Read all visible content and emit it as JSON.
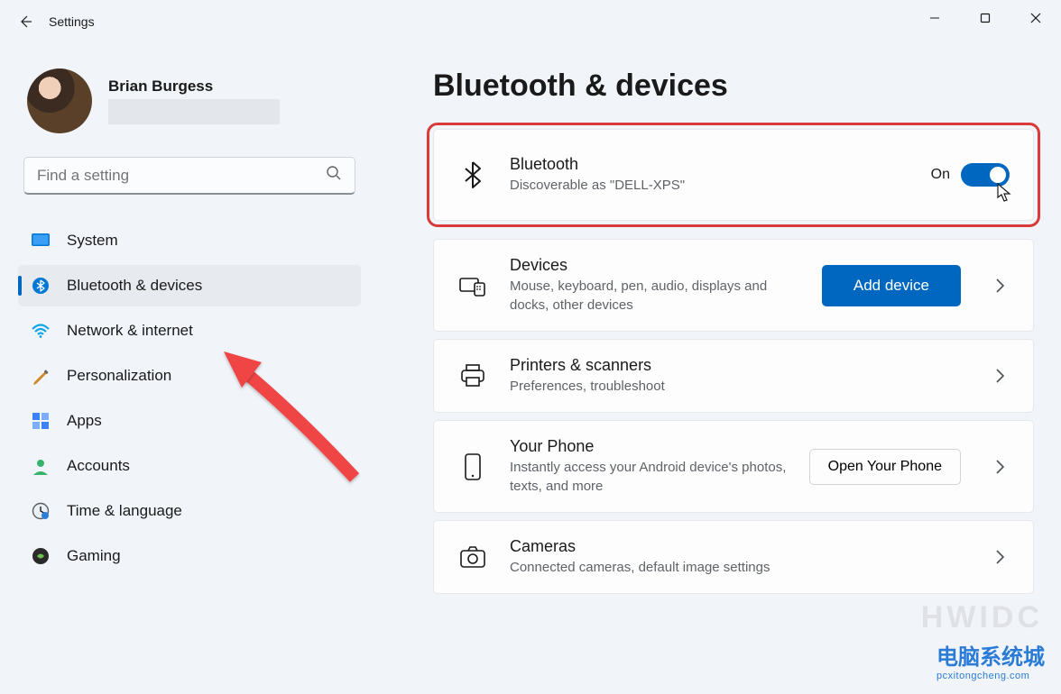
{
  "window": {
    "title": "Settings"
  },
  "profile": {
    "name": "Brian Burgess"
  },
  "search": {
    "placeholder": "Find a setting"
  },
  "sidebar": {
    "items": [
      {
        "label": "System"
      },
      {
        "label": "Bluetooth & devices"
      },
      {
        "label": "Network & internet"
      },
      {
        "label": "Personalization"
      },
      {
        "label": "Apps"
      },
      {
        "label": "Accounts"
      },
      {
        "label": "Time & language"
      },
      {
        "label": "Gaming"
      }
    ]
  },
  "page": {
    "title": "Bluetooth & devices"
  },
  "cards": {
    "bluetooth": {
      "title": "Bluetooth",
      "sub": "Discoverable as \"DELL-XPS\"",
      "toggle_label": "On"
    },
    "devices": {
      "title": "Devices",
      "sub": "Mouse, keyboard, pen, audio, displays and docks, other devices",
      "button": "Add device"
    },
    "printers": {
      "title": "Printers & scanners",
      "sub": "Preferences, troubleshoot"
    },
    "phone": {
      "title": "Your Phone",
      "sub": "Instantly access your Android device's photos, texts, and more",
      "button": "Open Your Phone"
    },
    "cameras": {
      "title": "Cameras",
      "sub": "Connected cameras, default image settings"
    }
  },
  "watermark": {
    "faded": "HWIDC",
    "brand": "电脑系统城",
    "url": "pcxitongcheng.com"
  }
}
